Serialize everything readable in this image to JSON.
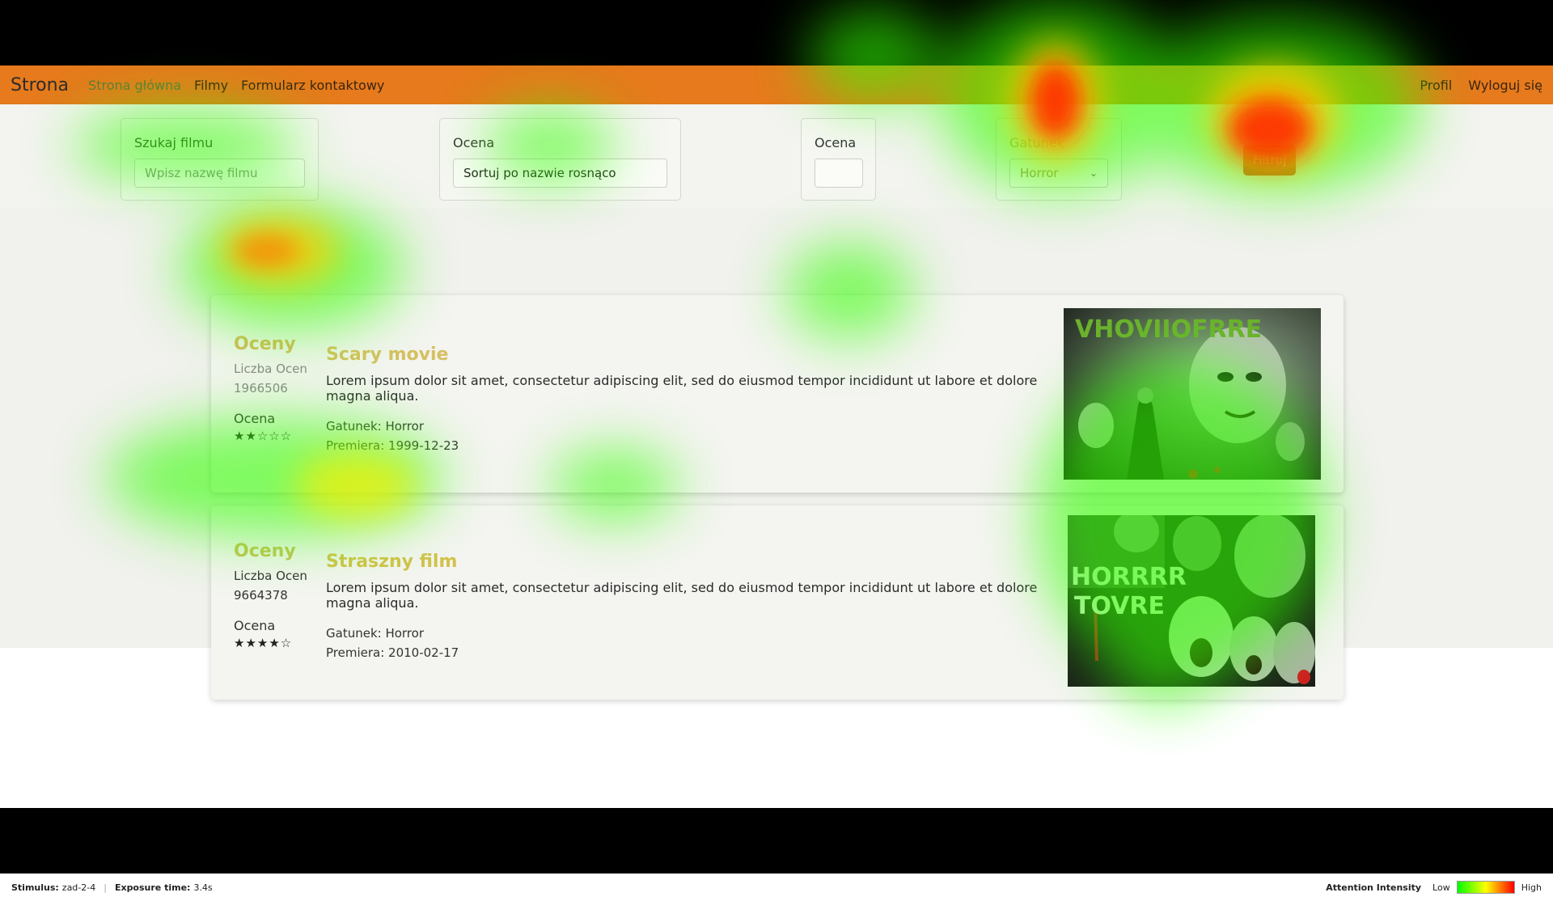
{
  "nav": {
    "brand": "Strona",
    "links": [
      "Strona główna",
      "Filmy",
      "Formularz kontaktowy"
    ],
    "right": [
      "Profil",
      "Wyloguj się"
    ]
  },
  "filters": {
    "search": {
      "label": "Szukaj filmu",
      "placeholder": "Wpisz nazwę filmu"
    },
    "sort": {
      "label": "Ocena",
      "value": "Sortuj po nazwie rosnąco"
    },
    "rating": {
      "label": "Ocena",
      "value": ""
    },
    "genre": {
      "label": "Gatunek",
      "value": "Horror"
    },
    "button": "Filtruj"
  },
  "movies": [
    {
      "ratings_title": "Oceny",
      "count_label": "Liczba Ocen",
      "count": "1966506",
      "rating_label": "Ocena",
      "stars": "★★☆☆☆",
      "title": "Scary movie",
      "description": "Lorem ipsum dolor sit amet, consectetur adipiscing elit, sed do eiusmod tempor incididunt ut labore et dolore magna aliqua.",
      "genre": "Gatunek: Horror",
      "premiere": "Premiera: 1999-12-23",
      "poster_text": "VHOVIIOFRRE"
    },
    {
      "ratings_title": "Oceny",
      "count_label": "Liczba Ocen",
      "count": "9664378",
      "rating_label": "Ocena",
      "stars": "★★★★☆",
      "title": "Straszny film",
      "description": "Lorem ipsum dolor sit amet, consectetur adipiscing elit, sed do eiusmod tempor incididunt ut labore et dolore magna aliqua.",
      "genre": "Gatunek: Horror",
      "premiere": "Premiera: 2010-02-17",
      "poster_text_1": "HORRRR",
      "poster_text_2": "TOVRE"
    }
  ],
  "footer": {
    "stimulus_label": "Stimulus:",
    "stimulus_value": "zad-2-4",
    "exposure_label": "Exposure time:",
    "exposure_value": "3.4s",
    "legend_title": "Attention Intensity",
    "legend_low": "Low",
    "legend_high": "High"
  },
  "colors": {
    "navbar": "#e67a1c",
    "filter_button": "#e53820",
    "heat_low": "#00ff00",
    "heat_high": "#ff0000"
  }
}
